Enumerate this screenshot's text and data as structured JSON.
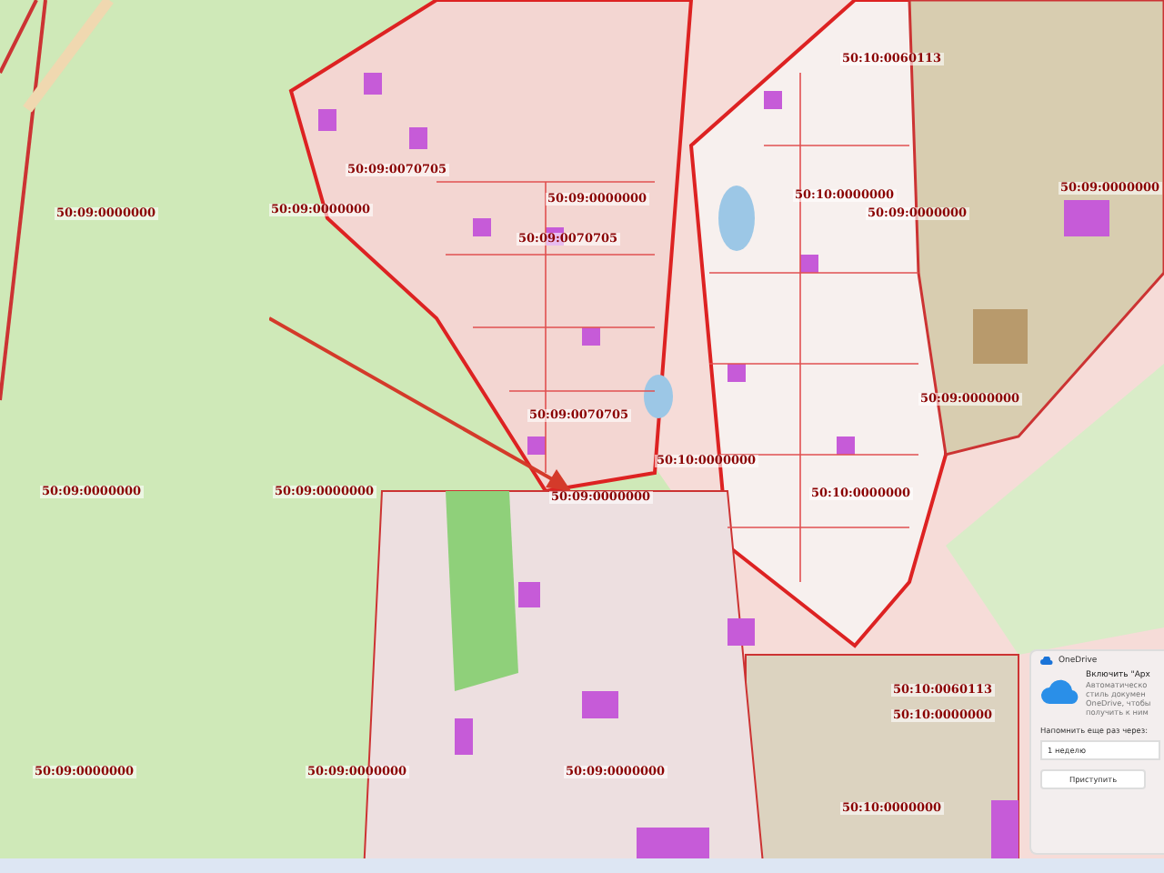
{
  "map": {
    "parcel_labels": [
      {
        "text": "50:09:0070705"
      },
      {
        "text": "50:09:0000000"
      },
      {
        "text": "50:09:0000000"
      },
      {
        "text": "50:09:0000000"
      },
      {
        "text": "50:09:0070705"
      },
      {
        "text": "50:09:0070705"
      },
      {
        "text": "50:09:0000000"
      },
      {
        "text": "50:09:0000000"
      },
      {
        "text": "50:09:0000000"
      },
      {
        "text": "50:10:0060113"
      },
      {
        "text": "50:10:0000000"
      },
      {
        "text": "50:09:0000000"
      },
      {
        "text": "50:09:0000000"
      },
      {
        "text": "50:09:0000000"
      },
      {
        "text": "50:10:0000000"
      },
      {
        "text": "50:10:0000000"
      },
      {
        "text": "50:10:0060113"
      },
      {
        "text": "50:10:0000000"
      },
      {
        "text": "50:09:0000000"
      },
      {
        "text": "50:09:0000000"
      },
      {
        "text": "50:09:0000000"
      },
      {
        "text": "50:10:0000000"
      }
    ]
  },
  "notification": {
    "app": "OneDrive",
    "title": "Включить \"Арх",
    "body_lines": [
      "Автоматическо",
      "стиль докумен",
      "OneDrive, чтобы",
      "получить к ним"
    ],
    "remind_label": "Напомнить еще раз через:",
    "remind_value": "1 неделю",
    "button": "Приступить"
  }
}
